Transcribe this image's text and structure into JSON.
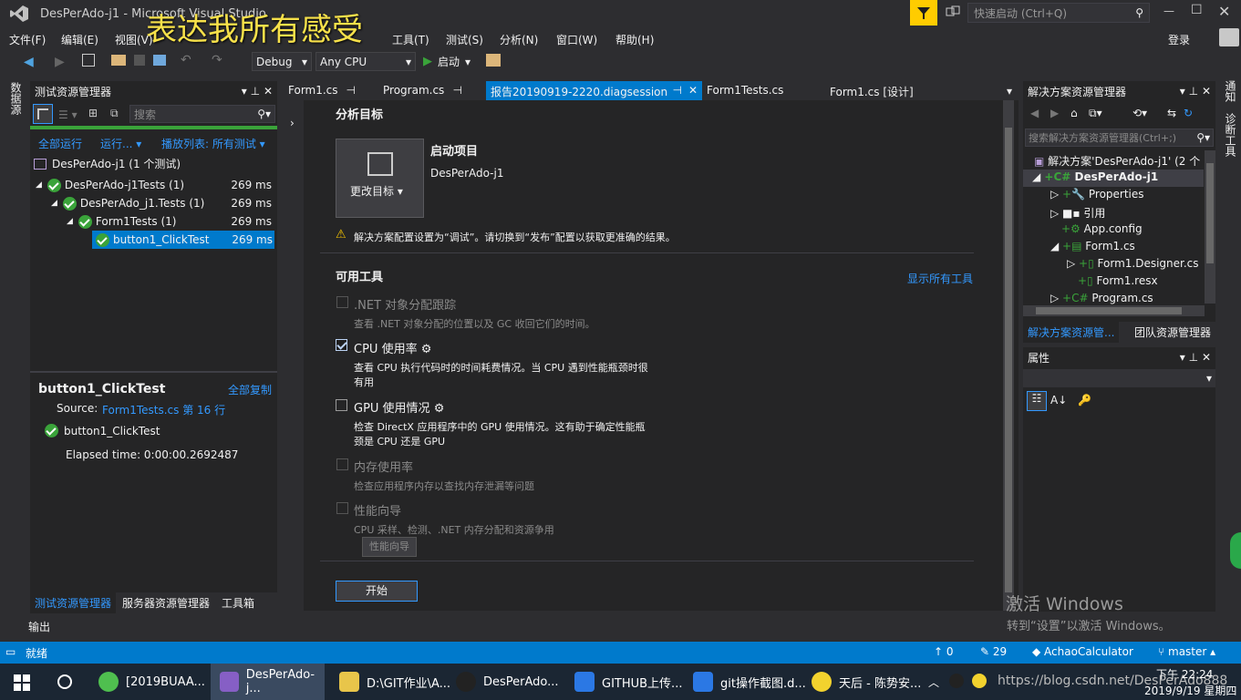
{
  "window": {
    "title": "DesPerAdo-j1 - Microsoft Visual Studio",
    "overlay_caption": "表达我所有感受"
  },
  "titlebar": {
    "quick_launch_placeholder": "快速启动 (Ctrl+Q)",
    "login": "登录"
  },
  "menu": [
    "文件(F)",
    "编辑(E)",
    "视图(V)",
    "工具(T)",
    "测试(S)",
    "分析(N)",
    "窗口(W)",
    "帮助(H)"
  ],
  "toolbar": {
    "config": "Debug",
    "platform": "Any CPU",
    "start": "启动"
  },
  "left_strip": {
    "label": "数据源"
  },
  "test_explorer": {
    "title": "测试资源管理器",
    "search_placeholder": "搜索",
    "run_all": "全部运行",
    "run": "运行...",
    "playlist": "播放列表: 所有测试",
    "root": "DesPerAdo-j1 (1 个测试)",
    "tree": [
      {
        "label": "DesPerAdo-j1Tests (1)",
        "time": "269 ms"
      },
      {
        "label": "DesPerAdo_j1.Tests (1)",
        "time": "269 ms"
      },
      {
        "label": "Form1Tests (1)",
        "time": "269 ms"
      },
      {
        "label": "button1_ClickTest",
        "time": "269 ms"
      }
    ],
    "detail": {
      "name": "button1_ClickTest",
      "copy_all": "全部复制",
      "source_label": "Source:",
      "source_link": "Form1Tests.cs 第 16 行",
      "result_name": "button1_ClickTest",
      "elapsed": "Elapsed time: 0:00:00.2692487"
    },
    "bottom_tabs": [
      "测试资源管理器",
      "服务器资源管理器",
      "工具箱"
    ]
  },
  "output_tab": "输出",
  "doc_tabs": [
    {
      "label": "Form1.cs"
    },
    {
      "label": "Program.cs"
    },
    {
      "label": "报告20190919-2220.diagsession"
    },
    {
      "label": "Form1Tests.cs"
    },
    {
      "label": "Form1.cs [设计]"
    }
  ],
  "diag": {
    "section_target": "分析目标",
    "change_target": "更改目标",
    "startup_title": "启动项目",
    "startup_name": "DesPerAdo-j1",
    "warning": "解决方案配置设置为“调试”。请切换到“发布”配置以获取更准确的结果。",
    "tools_title": "可用工具",
    "show_all": "显示所有工具",
    "tools": [
      {
        "name": ".NET 对象分配跟踪",
        "desc": "查看 .NET 对象分配的位置以及 GC 收回它们的时间。"
      },
      {
        "name": "CPU 使用率",
        "desc1": "查看 CPU 执行代码时的时间耗费情况。当 CPU 遇到性能瓶颈时很",
        "desc2": "有用"
      },
      {
        "name": "GPU 使用情况",
        "desc1": "检查 DirectX 应用程序中的 GPU 使用情况。这有助于确定性能瓶",
        "desc2": "颈是 CPU 还是 GPU"
      },
      {
        "name": "内存使用率",
        "desc": "检查应用程序内存以查找内存泄漏等问题"
      },
      {
        "name": "性能向导",
        "desc": "CPU 采样、检测、.NET 内存分配和资源争用",
        "button": "性能向导"
      }
    ],
    "start_button": "开始"
  },
  "solution_explorer": {
    "title": "解决方案资源管理器",
    "search_placeholder": "搜索解决方案资源管理器(Ctrl+;)",
    "items": [
      "解决方案'DesPerAdo-j1' (2 个",
      "DesPerAdo-j1",
      "Properties",
      "引用",
      "App.config",
      "Form1.cs",
      "Form1.Designer.cs",
      "Form1.resx",
      "Program.cs"
    ],
    "tabs": [
      "解决方案资源管...",
      "团队资源管理器"
    ]
  },
  "properties": {
    "title": "属性"
  },
  "right_strip": {
    "a": "通知",
    "b": "诊断工具"
  },
  "watermark": {
    "line1": "激活 Windows",
    "line2": "转到“设置”以激活 Windows。"
  },
  "statusbar": {
    "ready": "就绪",
    "up": "0",
    "edits": "29",
    "repo": "AchaoCalculator",
    "branch": "master"
  },
  "taskbar": {
    "items": [
      "[2019BUAA...",
      "DesPerAdo-j...",
      "D:\\GIT作业\\A...",
      "DesPerAdo...",
      "GITHUB上传...",
      "git操作截图.d...",
      "天后 - 陈势安..."
    ],
    "url_watermark": "https://blog.csdn.net/DesPerAdo888",
    "time": "下午 22:24",
    "date": "2019/9/19 星期四"
  },
  "colors": {
    "accent": "#007acc",
    "pass": "#3aa33a",
    "link": "#3399ff",
    "warn": "#f5c400"
  }
}
